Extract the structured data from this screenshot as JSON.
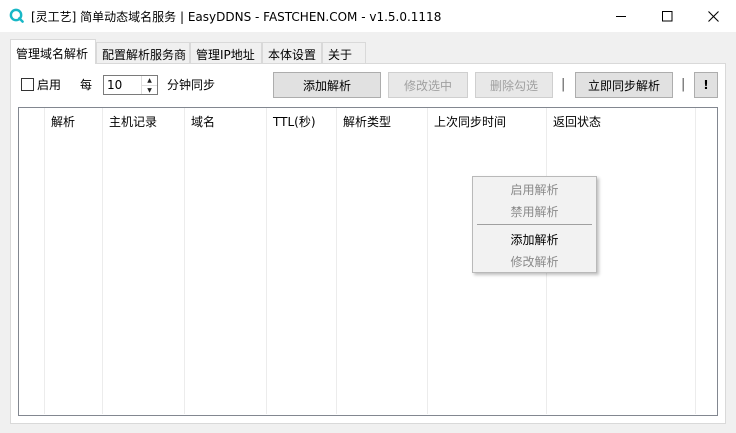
{
  "window": {
    "title": "[灵工艺] 简单动态域名服务 | EasyDDNS - FASTCHEN.COM - v1.5.0.1118",
    "controls": {
      "minimize": "—",
      "maximize": "☐",
      "close": "✕"
    },
    "accent_color": "#18b7c6"
  },
  "tabs": [
    "管理域名解析",
    "配置解析服务商",
    "管理IP地址",
    "本体设置",
    "关于"
  ],
  "toolbar": {
    "enable_label": "启用",
    "every_label": "每",
    "interval_value": "10",
    "minutes_label": "分钟同步",
    "add_button": "添加解析",
    "edit_button": "修改选中",
    "delete_button": "删除勾选",
    "separator": "|",
    "sync_button": "立即同步解析",
    "info_button": "!"
  },
  "table": {
    "columns": [
      "解析",
      "主机记录",
      "域名",
      "TTL(秒)",
      "解析类型",
      "上次同步时间",
      "返回状态"
    ],
    "rows": []
  },
  "context_menu": {
    "items": [
      {
        "label": "启用解析",
        "enabled": false
      },
      {
        "label": "禁用解析",
        "enabled": false
      },
      {
        "label": "添加解析",
        "enabled": true
      },
      {
        "label": "修改解析",
        "enabled": false
      }
    ]
  }
}
